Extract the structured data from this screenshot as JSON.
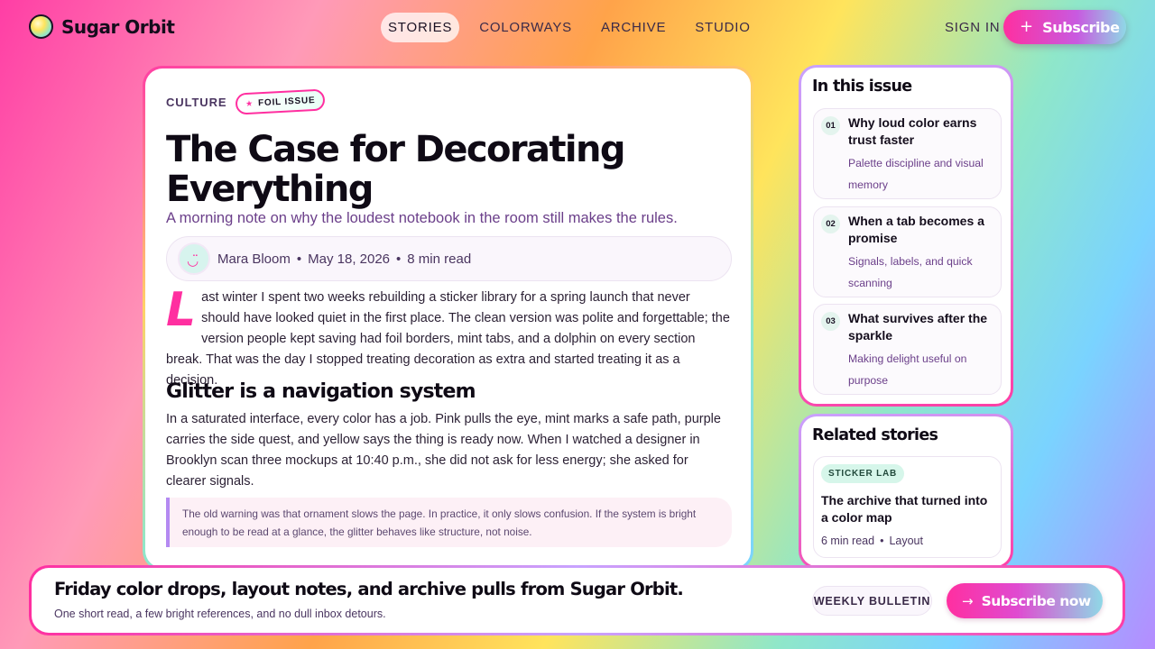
{
  "brand": {
    "name": "Sugar Orbit"
  },
  "nav": {
    "items": [
      {
        "label": "STORIES",
        "active": true
      },
      {
        "label": "COLORWAYS",
        "active": false
      },
      {
        "label": "ARCHIVE",
        "active": false
      },
      {
        "label": "STUDIO",
        "active": false
      }
    ]
  },
  "header": {
    "sign_in": "SIGN IN",
    "subscribe_label": "Subscribe",
    "subscribe_icon": "plus-icon"
  },
  "article": {
    "kicker": "CULTURE",
    "badge": "FOIL ISSUE",
    "badge_icon": "star-icon",
    "headline": "The Case for Decorating Everything",
    "dek": "A morning note on why the loudest notebook in the room still makes the rules.",
    "byline": {
      "author": "Mara Bloom",
      "date": "May 18, 2026",
      "read_time": "8 min read",
      "separator": "•"
    },
    "dropcap": "L",
    "paragraph1": "ast winter I spent two weeks rebuilding a sticker library for a spring launch that never should have looked quiet in the first place. The clean version was polite and forgettable; the version people kept saving had foil borders, mint tabs, and a dolphin on every section break. That was the day I stopped treating decoration as extra and started treating it as a decision.",
    "subheading": "Glitter is a navigation system",
    "paragraph2": "In a saturated interface, every color has a job. Pink pulls the eye, mint marks a safe path, purple carries the side quest, and yellow says the thing is ready now. When I watched a designer in Brooklyn scan three mockups at 10:40 p.m., she did not ask for less energy; she asked for clearer signals.",
    "pullquote": "The old warning was that ornament slows the page. In practice, it only slows confusion. If the system is bright enough to be read at a glance, the glitter behaves like structure, not noise."
  },
  "issue": {
    "title": "In this issue",
    "items": [
      {
        "num": "01",
        "title": "Why loud color earns trust faster",
        "desc": "Palette discipline and visual memory"
      },
      {
        "num": "02",
        "title": "When a tab becomes a promise",
        "desc": "Signals, labels, and quick scanning"
      },
      {
        "num": "03",
        "title": "What survives after the sparkle",
        "desc": "Making delight useful on purpose"
      }
    ]
  },
  "related": {
    "title": "Related stories",
    "items": [
      {
        "tag": "STICKER LAB",
        "title": "The archive that turned into a color map",
        "read_time": "6 min read",
        "section": "Layout"
      }
    ]
  },
  "bulletin": {
    "title": "Friday color drops, layout notes, and archive pulls from Sugar Orbit.",
    "subtitle": "One short read, a few bright references, and no dull inbox detours.",
    "tag": "WEEKLY BULLETIN",
    "button_label": "Subscribe now",
    "button_icon": "arrow-right-icon"
  },
  "colors": {
    "accent_pink": "#ff2fa0",
    "accent_purple": "#b48af2",
    "mint": "#d6f6ea",
    "text_dark": "#0f0a15"
  }
}
